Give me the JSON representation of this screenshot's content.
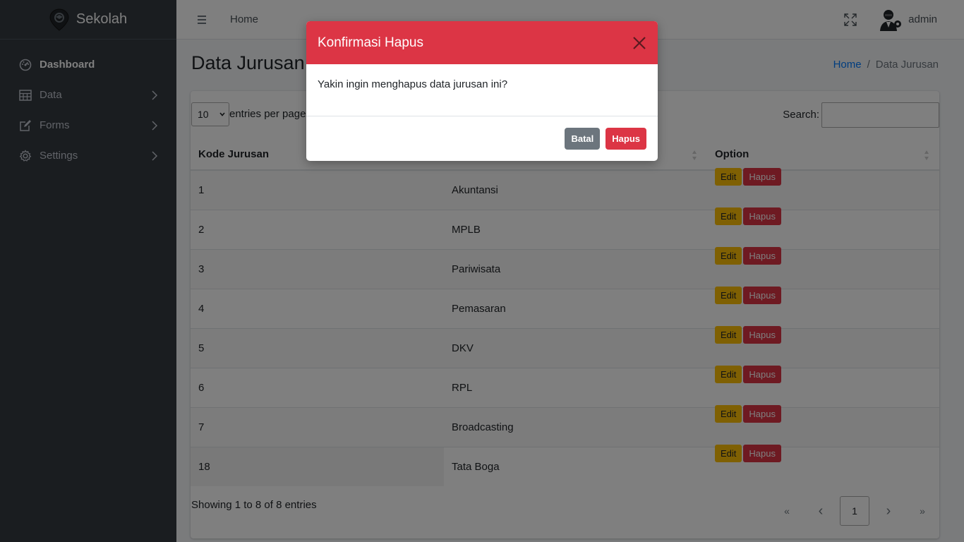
{
  "brand": {
    "name": "Sekolah"
  },
  "sidebar": {
    "items": [
      {
        "label": "Dashboard",
        "icon": "dashboard-icon",
        "active": true
      },
      {
        "label": "Data",
        "icon": "table-icon"
      },
      {
        "label": "Forms",
        "icon": "edit-icon"
      },
      {
        "label": "Settings",
        "icon": "gear-icon"
      }
    ]
  },
  "topbar": {
    "home_label": "Home",
    "user_name": "admin"
  },
  "page": {
    "title": "Data Jurusan",
    "breadcrumb": {
      "home": "Home",
      "separator": "/",
      "current": "Data Jurusan"
    }
  },
  "table": {
    "length_value": "10",
    "length_suffix": "entries per page",
    "search_label": "Search:",
    "columns": [
      "Kode Jurusan",
      "Option"
    ],
    "edit_label": "Edit",
    "delete_label": "Hapus",
    "rows": [
      {
        "kode": "1",
        "nama": "Akuntansi"
      },
      {
        "kode": "2",
        "nama": "MPLB"
      },
      {
        "kode": "3",
        "nama": "Pariwisata"
      },
      {
        "kode": "4",
        "nama": "Pemasaran"
      },
      {
        "kode": "5",
        "nama": "DKV"
      },
      {
        "kode": "6",
        "nama": "RPL"
      },
      {
        "kode": "7",
        "nama": "Broadcasting"
      },
      {
        "kode": "18",
        "nama": "Tata Boga"
      }
    ],
    "info": "Showing 1 to 8 of 8 entries",
    "pager": {
      "first": "«",
      "prev": "‹",
      "current": "1",
      "next": "›",
      "last": "»"
    }
  },
  "modal": {
    "title": "Konfirmasi Hapus",
    "message": "Yakin ingin menghapus data jurusan ini?",
    "cancel_label": "Batal",
    "confirm_label": "Hapus"
  },
  "colors": {
    "danger": "#dc3545",
    "warning": "#ffc107",
    "secondary": "#6c757d",
    "sidebar_bg": "#343a40",
    "link": "#007bff"
  }
}
